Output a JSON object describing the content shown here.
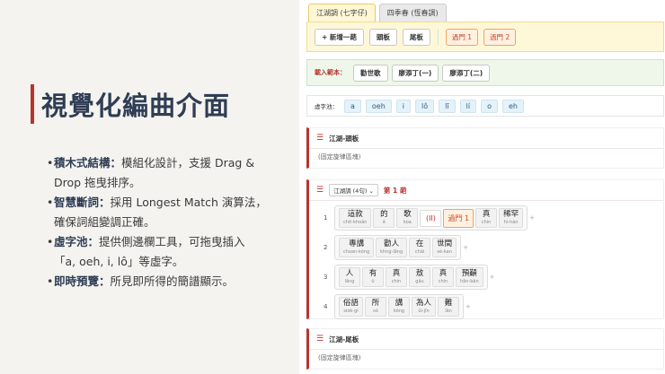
{
  "slide": {
    "title": "視覺化編曲介面",
    "bullets": [
      {
        "label": "積木式結構：",
        "lines": [
          "模組化設計，支援 Drag &",
          "Drop 拖曳排序。"
        ]
      },
      {
        "label": "智慧斷詞：",
        "lines": [
          "採用 Longest Match 演算法，",
          "確保詞組變調正確。"
        ]
      },
      {
        "label": "虛字池：",
        "lines": [
          "提供側邊欄工具，可拖曳插入",
          "「a, oeh, i, lô」等虛字。"
        ]
      },
      {
        "label": "即時預覽：",
        "lines": [
          "所見即所得的簡譜顯示。"
        ]
      }
    ]
  },
  "app": {
    "tabs": [
      "江湖調 (七字仔)",
      "四季春 (恆春調)"
    ],
    "toolbar": {
      "add": "+ 新增一葩",
      "head": "頭板",
      "tail": "尾板",
      "gates": [
        "過門 1",
        "過門 2"
      ]
    },
    "loader": {
      "label": "載入範本：",
      "items": [
        "勸世歌",
        "廖添丁(一)",
        "廖添丁(二)"
      ]
    },
    "pool": {
      "label": "虛字池：",
      "chips": [
        "a",
        "oeh",
        "i",
        "lô",
        "lī",
        "lí",
        "o",
        "eh"
      ]
    },
    "head_section": {
      "title": "江湖-頭板",
      "note": "(固定旋律區塊)"
    },
    "verse_section": {
      "select": "江湖調 (4句)",
      "number": "第 1 葩",
      "rows": [
        {
          "n": "1",
          "cells": [
            {
              "z": "這款",
              "p": "chit-khoán"
            },
            {
              "z": "的",
              "p": "ê"
            },
            {
              "z": "歌",
              "p": "koa"
            },
            {
              "sym": "(II)"
            },
            {
              "gate": "過門 1"
            },
            {
              "z": "真",
              "p": "chin"
            },
            {
              "z": "稀罕",
              "p": "hi-hán"
            }
          ]
        },
        {
          "n": "2",
          "cells": [
            {
              "z": "專講",
              "p": "choan-kóng"
            },
            {
              "z": "勸人",
              "p": "khng-lâng"
            },
            {
              "z": "在",
              "p": "chāi"
            },
            {
              "z": "世間",
              "p": "sè-kan"
            }
          ]
        },
        {
          "n": "3",
          "cells": [
            {
              "z": "人",
              "p": "lâng"
            },
            {
              "z": "有",
              "p": "ū"
            },
            {
              "z": "真",
              "p": "chin"
            },
            {
              "z": "敖",
              "p": "gâu"
            },
            {
              "z": "真",
              "p": "chin"
            },
            {
              "z": "預顢",
              "p": "hân-bān"
            }
          ]
        },
        {
          "n": "4",
          "cells": [
            {
              "z": "俗語",
              "p": "siok-gí"
            },
            {
              "z": "所",
              "p": "só"
            },
            {
              "z": "講",
              "p": "kóng"
            },
            {
              "z": "為人",
              "p": "ûi-jîn"
            },
            {
              "z": "難",
              "p": "lân"
            }
          ]
        }
      ]
    },
    "tail_section": {
      "title": "江湖-尾板",
      "note": "(固定旋律區塊)"
    }
  }
}
